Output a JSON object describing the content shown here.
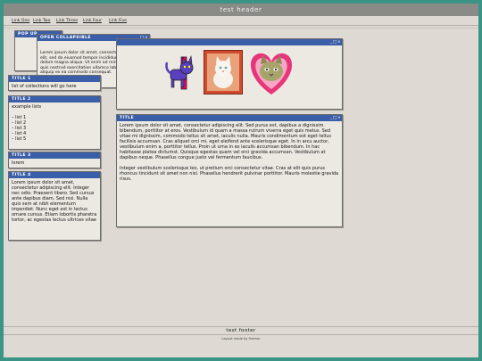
{
  "header": {
    "title": "test header"
  },
  "nav": {
    "items": [
      "Link One",
      "Link Two",
      "Link Three",
      "Link Four",
      "Link Five"
    ]
  },
  "popup": {
    "title": "POP UP"
  },
  "collapsible": {
    "title": "OPEN COLLAPSIBLE",
    "body": "Lorem ipsum dolor sit amet, consectetur adipiscing elit, sed do eiusmod tempor incididunt ut labore et dolore magna aliqua. Ut enim ad minim veniam, quis nostrud exercitation ullamco laboris nisi ut aliquip ex ea commodo consequat."
  },
  "controls": {
    "minimize": "_",
    "maximize": "□",
    "close": "×"
  },
  "title1": {
    "title": "TITLE 1",
    "body": "list of collections will go here"
  },
  "title2": {
    "title": "TITLE 2",
    "heading": "example lists",
    "items": [
      "– list 1",
      "– list 2",
      "– list 3",
      "– list 4",
      "– list 5"
    ]
  },
  "title3": {
    "title": "TITLE 3",
    "body": "lorem"
  },
  "title4": {
    "title": "TITLE 4",
    "body": "Lorem ipsum dolor sit amet, consectetur adipiscing elit. Integer nec odio. Praesent libero. Sed cursus ante dapibus diam. Sed nisi. Nulla quis sem at nibh elementum imperdiet. Nunc eget est in lectus ornare cursus. Etiam lobortis pharetra tortor, ac egestas lectus ultrices vitae"
  },
  "main": {
    "title": "TITLE",
    "para1": "Lorem ipsum dolor sit amet, consectetur adipiscing elit. Sed purus est, dapibus a dignissim bibendum, porttitor at eros. Vestibulum id quam a massa rutrum viverra eget quis metus. Sed vitae mi dignissim, commodo tellus sit amet, iaculis nulla. Mauris condimentum est eget tellus facilisis accumsan. Cras aliquet orci mi, eget eleifend ante scelerisque eget. In in arcu auctor, vestibulum enim a, porttitor tellus. Proin ut urna in ex iaculis accumsan bibendum. In hac habitasse platea dictumst. Quisque egestas quam vel orci gravida accumsan. Vestibulum at dapibus neque. Phasellus congue justo vel fermentum faucibus.",
    "para2": "Integer vestibulum scelerisque leo, ut pretium orci consectetur vitae. Cras at elit quis purus rhoncus tincidunt sit amet non nisl. Phasellus hendrerit pulvinar porttitor. Mauris molestie gravida risus."
  },
  "footer": {
    "title": "test footer",
    "credit": "Layout made by firamar"
  }
}
